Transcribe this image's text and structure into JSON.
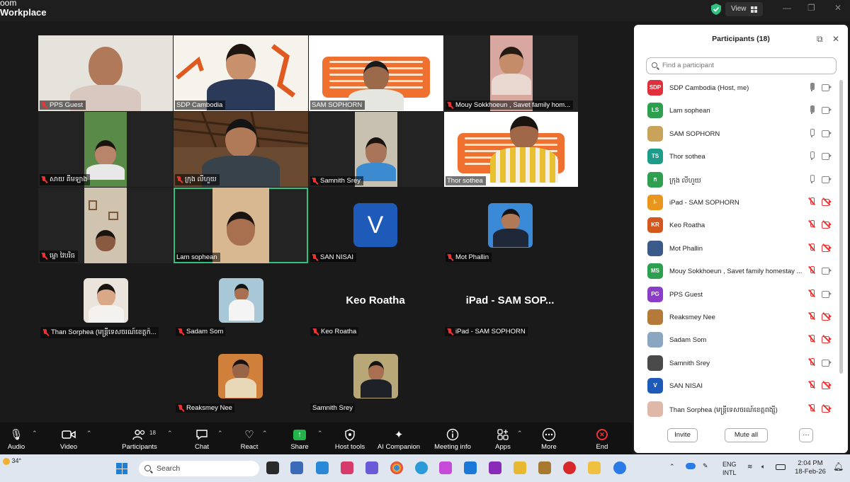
{
  "window": {
    "app_title_line1": "oom",
    "app_title_line2": "Workplace",
    "view_label": "View"
  },
  "tiles": [
    {
      "name": "PPS Guest",
      "muted": true
    },
    {
      "name": "SDP Cambodia",
      "muted": false
    },
    {
      "name": "SAM SOPHORN",
      "muted": false
    },
    {
      "name": "Mouy Sokkhoeun , Savet family hom...",
      "muted": true
    },
    {
      "name": "សាយ គីមឡាង",
      "muted": true
    },
    {
      "name": "ក្រុ​ង លីហួយ",
      "muted": false
    },
    {
      "name": "Samnith Srey",
      "muted": true
    },
    {
      "name": "Thor sothea",
      "muted": false
    },
    {
      "name": "ម្លោ វៃបរិធ",
      "muted": true
    },
    {
      "name": "Lam sophean",
      "muted": false
    },
    {
      "name": "SAN NISAI",
      "muted": true
    },
    {
      "name": "Mot Phallin",
      "muted": true
    }
  ],
  "san_nisai_initial": "V",
  "row4": {
    "than_sorphea": "Than Sorphea (មន្ត្រីទេសចរណ៍ខេត្តក៉...",
    "sadam_som": "Sadam Som",
    "keo_roatha_big": "Keo Roatha",
    "keo_roatha_tag": "Keo Roatha",
    "ipad_big": "iPad - SAM SOP...",
    "ipad_tag": "iPad - SAM SOPHORN"
  },
  "row5": {
    "reaksmey": "Reaksmey Nee",
    "samnith": "Samnith Srey"
  },
  "toolbar": {
    "audio": "Audio",
    "video": "Video",
    "participants": "Participants",
    "participants_count": "18",
    "chat": "Chat",
    "react": "React",
    "share": "Share",
    "host_tools": "Host tools",
    "ai_companion": "AI Companion",
    "meeting_info": "Meeting info",
    "apps": "Apps",
    "more": "More",
    "end": "End"
  },
  "panel": {
    "title": "Participants (18)",
    "search_placeholder": "Find a participant",
    "invite": "Invite",
    "mute_all": "Mute all",
    "more": "···",
    "participants": [
      {
        "initials": "SDP",
        "name": "SDP Cambodia (Host, me)",
        "color": "#e0303c",
        "mic": "on",
        "video": "on"
      },
      {
        "initials": "LS",
        "name": "Lam sophean",
        "color": "#2e9e4f",
        "mic": "on",
        "video": "on"
      },
      {
        "initials": "",
        "name": "SAM SOPHORN",
        "color": "#c9a35a",
        "mic": "idle",
        "video": "on"
      },
      {
        "initials": "TS",
        "name": "Thor sothea",
        "color": "#1e9c8a",
        "mic": "idle",
        "video": "on"
      },
      {
        "initials": "ក",
        "name": "ក្រុ​ង លីហួយ",
        "color": "#2e9e4f",
        "mic": "idle",
        "video": "on"
      },
      {
        "initials": "I-",
        "name": "iPad - SAM SOPHORN",
        "color": "#e8961e",
        "mic": "off",
        "video": "off"
      },
      {
        "initials": "KR",
        "name": "Keo Roatha",
        "color": "#d2581e",
        "mic": "off",
        "video": "off"
      },
      {
        "initials": "",
        "name": "Mot Phallin",
        "color": "#3a5a8a",
        "mic": "off",
        "video": "off"
      },
      {
        "initials": "MS",
        "name": "Mouy Sokkhoeun , Savet family homestay ...",
        "color": "#2e9e4f",
        "mic": "off",
        "video": "on"
      },
      {
        "initials": "PG",
        "name": "PPS Guest",
        "color": "#8a3ec8",
        "mic": "off",
        "video": "on"
      },
      {
        "initials": "",
        "name": "Reaksmey Nee",
        "color": "#b5793a",
        "mic": "off",
        "video": "off"
      },
      {
        "initials": "",
        "name": "Sadam Som",
        "color": "#8aa6c0",
        "mic": "off",
        "video": "off"
      },
      {
        "initials": "",
        "name": "Samnith Srey",
        "color": "#4a4a4a",
        "mic": "off",
        "video": "on"
      },
      {
        "initials": "V",
        "name": "SAN NISAI",
        "color": "#1e5bb8",
        "mic": "off",
        "video": "off"
      },
      {
        "initials": "",
        "name": "Than Sorphea (មន្ត្រីទេសចរណ៍ខេត្តពង្ស៊ី)",
        "color": "#e0b8a8",
        "mic": "off",
        "video": "off"
      }
    ]
  },
  "taskbar": {
    "temp": "34°",
    "search": "Search",
    "lang1": "ENG",
    "lang2": "INTL",
    "time": "2:04 PM",
    "date": "18-Feb-26"
  }
}
